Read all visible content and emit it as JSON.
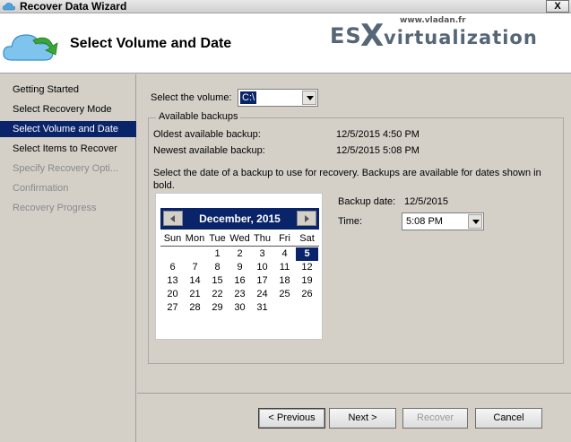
{
  "window": {
    "title": "Recover Data Wizard",
    "close_label": "X"
  },
  "header": {
    "page_title": "Select Volume and Date"
  },
  "logo": {
    "site": "www.vladan.fr",
    "brand_a": "ES",
    "brand_x": "X",
    "brand_b": "virtualization"
  },
  "steps": [
    {
      "label": "Getting Started",
      "state": "normal"
    },
    {
      "label": "Select Recovery Mode",
      "state": "normal"
    },
    {
      "label": "Select Volume and Date",
      "state": "active"
    },
    {
      "label": "Select Items to Recover",
      "state": "normal"
    },
    {
      "label": "Specify Recovery Opti...",
      "state": "disabled"
    },
    {
      "label": "Confirmation",
      "state": "disabled"
    },
    {
      "label": "Recovery Progress",
      "state": "disabled"
    }
  ],
  "volume": {
    "label": "Select the volume:",
    "value": "C:\\"
  },
  "backups": {
    "legend": "Available backups",
    "oldest_label": "Oldest available backup:",
    "oldest_value": "12/5/2015 4:50 PM",
    "newest_label": "Newest available backup:",
    "newest_value": "12/5/2015 5:08 PM",
    "instruction": "Select the date of a backup to use for recovery. Backups are available for dates shown in bold."
  },
  "calendar": {
    "title": "December, 2015",
    "weekdays": [
      "Sun",
      "Mon",
      "Tue",
      "Wed",
      "Thu",
      "Fri",
      "Sat"
    ],
    "days": [
      {
        "d": "1",
        "col": 2,
        "row": 0
      },
      {
        "d": "2",
        "col": 3,
        "row": 0
      },
      {
        "d": "3",
        "col": 4,
        "row": 0
      },
      {
        "d": "4",
        "col": 5,
        "row": 0
      },
      {
        "d": "5",
        "col": 6,
        "row": 0,
        "selected": true
      },
      {
        "d": "6",
        "col": 0,
        "row": 1
      },
      {
        "d": "7",
        "col": 1,
        "row": 1
      },
      {
        "d": "8",
        "col": 2,
        "row": 1
      },
      {
        "d": "9",
        "col": 3,
        "row": 1
      },
      {
        "d": "10",
        "col": 4,
        "row": 1
      },
      {
        "d": "11",
        "col": 5,
        "row": 1
      },
      {
        "d": "12",
        "col": 6,
        "row": 1
      },
      {
        "d": "13",
        "col": 0,
        "row": 2
      },
      {
        "d": "14",
        "col": 1,
        "row": 2
      },
      {
        "d": "15",
        "col": 2,
        "row": 2
      },
      {
        "d": "16",
        "col": 3,
        "row": 2
      },
      {
        "d": "17",
        "col": 4,
        "row": 2
      },
      {
        "d": "18",
        "col": 5,
        "row": 2
      },
      {
        "d": "19",
        "col": 6,
        "row": 2
      },
      {
        "d": "20",
        "col": 0,
        "row": 3
      },
      {
        "d": "21",
        "col": 1,
        "row": 3
      },
      {
        "d": "22",
        "col": 2,
        "row": 3
      },
      {
        "d": "23",
        "col": 3,
        "row": 3
      },
      {
        "d": "24",
        "col": 4,
        "row": 3
      },
      {
        "d": "25",
        "col": 5,
        "row": 3
      },
      {
        "d": "26",
        "col": 6,
        "row": 3
      },
      {
        "d": "27",
        "col": 0,
        "row": 4
      },
      {
        "d": "28",
        "col": 1,
        "row": 4
      },
      {
        "d": "29",
        "col": 2,
        "row": 4
      },
      {
        "d": "30",
        "col": 3,
        "row": 4
      },
      {
        "d": "31",
        "col": 4,
        "row": 4
      }
    ]
  },
  "backup_date": {
    "label": "Backup date:",
    "value": "12/5/2015"
  },
  "time": {
    "label": "Time:",
    "value": "5:08 PM"
  },
  "buttons": {
    "previous": "< Previous",
    "next": "Next >",
    "recover": "Recover",
    "cancel": "Cancel"
  },
  "colors": {
    "selection": "#0a246a",
    "panel": "#d4d0c8",
    "disabled_text": "#8a8a8a"
  },
  "icons": {
    "app": "cloud-icon",
    "header": "cloud-recover-icon"
  }
}
